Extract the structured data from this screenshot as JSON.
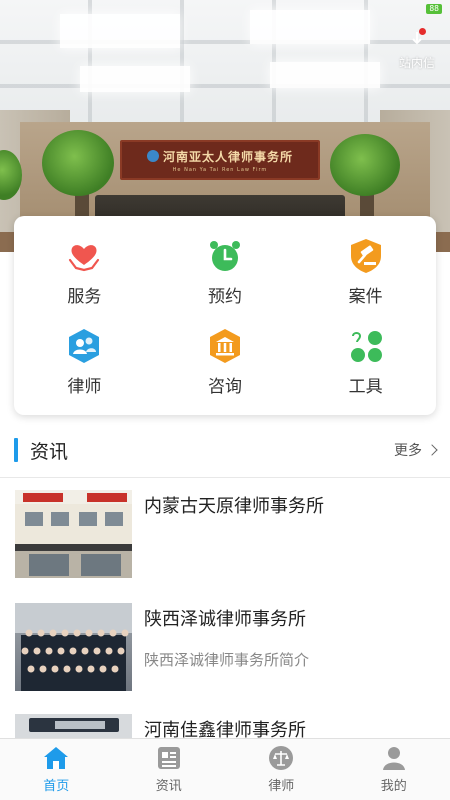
{
  "status": {
    "battery": "88"
  },
  "hero": {
    "sign_title": "河南亚太人律师事务所",
    "sign_subtitle": "He Nan Ya Tai Ren Law Firm",
    "message_label": "站内信"
  },
  "menu": {
    "items": [
      {
        "label": "服务",
        "icon": "heart-hands-icon",
        "color": "#f0564f"
      },
      {
        "label": "预约",
        "icon": "alarm-clock-icon",
        "color": "#3dbb5a"
      },
      {
        "label": "案件",
        "icon": "gavel-icon",
        "color": "#f39b1e"
      },
      {
        "label": "律师",
        "icon": "lawyer-badge-icon",
        "color": "#2a9fe0"
      },
      {
        "label": "咨询",
        "icon": "courthouse-icon",
        "color": "#f39b1e"
      },
      {
        "label": "工具",
        "icon": "tools-grid-icon",
        "color": "#3dbb5a"
      }
    ]
  },
  "news": {
    "section_title": "资讯",
    "more_label": "更多",
    "items": [
      {
        "title": "内蒙古天原律师事务所",
        "summary": ""
      },
      {
        "title": "陕西泽诚律师事务所",
        "summary": "陕西泽诚律师事务所简介"
      },
      {
        "title": "河南佳鑫律师事务所",
        "summary": ""
      }
    ]
  },
  "bottom_nav": {
    "items": [
      {
        "label": "首页",
        "icon": "home-icon",
        "active": true
      },
      {
        "label": "资讯",
        "icon": "news-icon",
        "active": false
      },
      {
        "label": "律师",
        "icon": "scales-icon",
        "active": false
      },
      {
        "label": "我的",
        "icon": "profile-icon",
        "active": false
      }
    ]
  },
  "colors": {
    "accent": "#1e9bea",
    "card_bg": "#ffffff"
  }
}
